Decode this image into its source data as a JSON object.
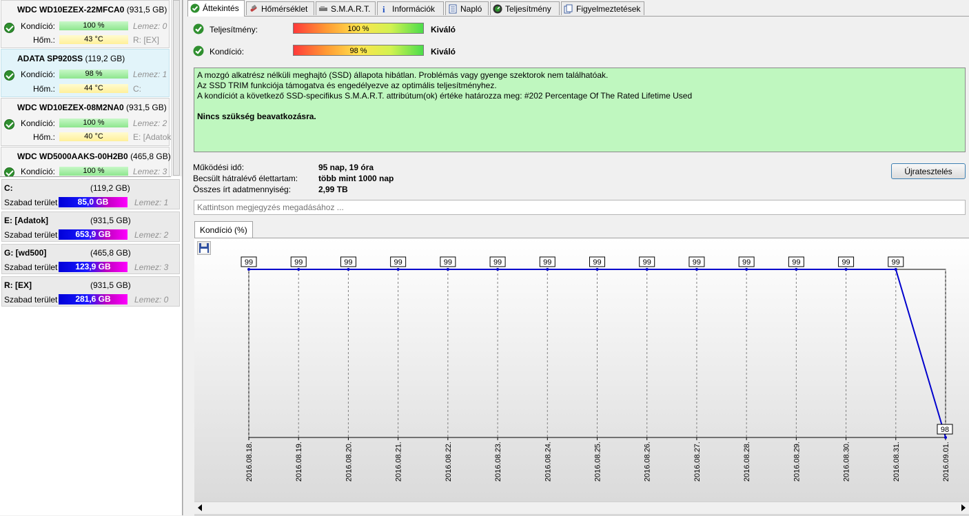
{
  "disks": [
    {
      "model": "WDC WD10EZEX-22MFCA0",
      "size": "(931,5 GB)",
      "health_label": "Kondíció:",
      "health": "100 %",
      "temp_label": "Hőm.:",
      "temp": "43 °C",
      "disk": "Lemez: 0",
      "drive": "R: [EX]"
    },
    {
      "model": "ADATA SP920SS",
      "size": "(119,2 GB)",
      "health_label": "Kondíció:",
      "health": "98 %",
      "temp_label": "Hőm.:",
      "temp": "44 °C",
      "disk": "Lemez: 1",
      "drive": "C:"
    },
    {
      "model": "WDC WD10EZEX-08M2NA0",
      "size": "(931,5 GB)",
      "health_label": "Kondíció:",
      "health": "100 %",
      "temp_label": "Hőm.:",
      "temp": "40 °C",
      "disk": "Lemez: 2",
      "drive": "E: [Adatok"
    },
    {
      "model": "WDC WD5000AAKS-00H2B0",
      "size": "(465,8 GB)",
      "health_label": "Kondíció:",
      "health": "100 %",
      "disk": "Lemez: 3"
    }
  ],
  "volumes": [
    {
      "name": "C:",
      "size": "(119,2 GB)",
      "free_label": "Szabad terület",
      "free": "85,0 GB",
      "free_fraction": 0.71,
      "disk": "Lemez: 1"
    },
    {
      "name": "E: [Adatok]",
      "size": "(931,5 GB)",
      "free_label": "Szabad terület",
      "free": "653,9 GB",
      "free_fraction": 0.7,
      "disk": "Lemez: 2"
    },
    {
      "name": "G: [wd500]",
      "size": "(465,8 GB)",
      "free_label": "Szabad terület",
      "free": "123,9 GB",
      "free_fraction": 0.27,
      "disk": "Lemez: 3"
    },
    {
      "name": "R: [EX]",
      "size": "(931,5 GB)",
      "free_label": "Szabad terület",
      "free": "281,6 GB",
      "free_fraction": 0.3,
      "disk": "Lemez: 0"
    }
  ],
  "tabs": [
    {
      "label": "Áttekintés",
      "icon": "check-icon",
      "active": true
    },
    {
      "label": "Hőmérséklet",
      "icon": "thermometer-icon"
    },
    {
      "label": "S.M.A.R.T.",
      "icon": "smart-icon"
    },
    {
      "label": "Információk",
      "icon": "info-icon"
    },
    {
      "label": "Napló",
      "icon": "log-icon"
    },
    {
      "label": "Teljesítmény",
      "icon": "performance-icon"
    },
    {
      "label": "Figyelmeztetések",
      "icon": "alerts-icon"
    }
  ],
  "overview": {
    "performance_label": "Teljesítmény:",
    "performance_value": "100 %",
    "performance_rating": "Kiváló",
    "health_label": "Kondíció:",
    "health_value": "98 %",
    "health_rating": "Kiváló",
    "info_lines": [
      "A mozgó alkatrész nélküli meghajtó (SSD) állapota hibátlan. Problémás vagy gyenge szektorok nem találhatóak.",
      "Az SSD TRIM funkciója támogatva és engedélyezve az optimális teljesítményhez.",
      "A kondíciót a következő SSD-specifikus S.M.A.R.T. attribútum(ok) értéke határozza meg:  #202 Percentage Of The Rated Lifetime Used"
    ],
    "info_conclusion": "Nincs szükség beavatkozásra.",
    "uptime_label": "Működési idő:",
    "uptime": "95 nap, 19 óra",
    "remaining_label": "Becsült hátralévő élettartam:",
    "remaining": "több mint 1000 nap",
    "written_label": "Összes írt adatmennyiség:",
    "written": "2,99 TB",
    "retest_label": "Újratesztelés",
    "note_placeholder": "Kattintson megjegyzés megadásához ..."
  },
  "chart_tab_label": "Kondíció  (%)",
  "chart_data": {
    "type": "line",
    "x": [
      "2016.08.18.",
      "2016.08.19.",
      "2016.08.20.",
      "2016.08.21.",
      "2016.08.22.",
      "2016.08.23.",
      "2016.08.24.",
      "2016.08.25.",
      "2016.08.26.",
      "2016.08.27.",
      "2016.08.28.",
      "2016.08.29.",
      "2016.08.30.",
      "2016.08.31.",
      "2016.09.01."
    ],
    "values": [
      99,
      99,
      99,
      99,
      99,
      99,
      99,
      99,
      99,
      99,
      99,
      99,
      99,
      99,
      98
    ],
    "ylim": [
      98,
      99
    ],
    "line_color": "#0000cc",
    "grid": "vertical dashed"
  }
}
